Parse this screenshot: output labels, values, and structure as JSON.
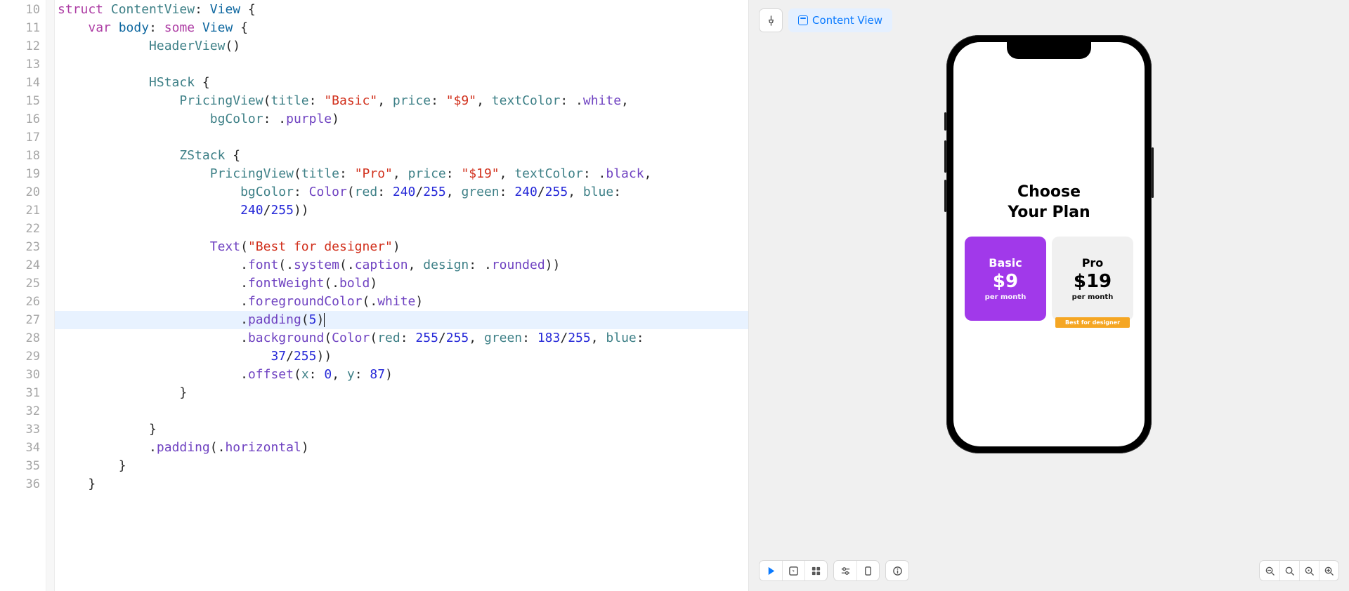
{
  "editor": {
    "startLine": 10,
    "highlightLine": 27,
    "lines": [
      [
        [
          "kw",
          "struct"
        ],
        [
          "plain",
          " "
        ],
        [
          "type",
          "ContentView"
        ],
        [
          "plain",
          ": "
        ],
        [
          "id",
          "View"
        ],
        [
          "plain",
          " {"
        ]
      ],
      [
        [
          "plain",
          "    "
        ],
        [
          "kw",
          "var"
        ],
        [
          "plain",
          " "
        ],
        [
          "id",
          "body"
        ],
        [
          "plain",
          ": "
        ],
        [
          "kw",
          "some"
        ],
        [
          "plain",
          " "
        ],
        [
          "id",
          "View"
        ],
        [
          "plain",
          " {"
        ]
      ],
      [
        [
          "plain",
          "            "
        ],
        [
          "type",
          "HeaderView"
        ],
        [
          "plain",
          "()"
        ]
      ],
      [
        [
          "plain",
          ""
        ]
      ],
      [
        [
          "plain",
          "            "
        ],
        [
          "type",
          "HStack"
        ],
        [
          "plain",
          " {"
        ]
      ],
      [
        [
          "plain",
          "                "
        ],
        [
          "type",
          "PricingView"
        ],
        [
          "plain",
          "("
        ],
        [
          "param",
          "title"
        ],
        [
          "plain",
          ": "
        ],
        [
          "str",
          "\"Basic\""
        ],
        [
          "plain",
          ", "
        ],
        [
          "param",
          "price"
        ],
        [
          "plain",
          ": "
        ],
        [
          "str",
          "\"$9\""
        ],
        [
          "plain",
          ", "
        ],
        [
          "param",
          "textColor"
        ],
        [
          "plain",
          ": ."
        ],
        [
          "enum",
          "white"
        ],
        [
          "plain",
          ","
        ]
      ],
      [
        [
          "plain",
          "                    "
        ],
        [
          "param",
          "bgColor"
        ],
        [
          "plain",
          ": ."
        ],
        [
          "enum",
          "purple"
        ],
        [
          "plain",
          ")"
        ]
      ],
      [
        [
          "plain",
          ""
        ]
      ],
      [
        [
          "plain",
          "                "
        ],
        [
          "type",
          "ZStack"
        ],
        [
          "plain",
          " {"
        ]
      ],
      [
        [
          "plain",
          "                    "
        ],
        [
          "type",
          "PricingView"
        ],
        [
          "plain",
          "("
        ],
        [
          "param",
          "title"
        ],
        [
          "plain",
          ": "
        ],
        [
          "str",
          "\"Pro\""
        ],
        [
          "plain",
          ", "
        ],
        [
          "param",
          "price"
        ],
        [
          "plain",
          ": "
        ],
        [
          "str",
          "\"$19\""
        ],
        [
          "plain",
          ", "
        ],
        [
          "param",
          "textColor"
        ],
        [
          "plain",
          ": ."
        ],
        [
          "enum",
          "black"
        ],
        [
          "plain",
          ","
        ]
      ],
      [
        [
          "plain",
          "                        "
        ],
        [
          "param",
          "bgColor"
        ],
        [
          "plain",
          ": "
        ],
        [
          "typeP",
          "Color"
        ],
        [
          "plain",
          "("
        ],
        [
          "param",
          "red"
        ],
        [
          "plain",
          ": "
        ],
        [
          "num",
          "240"
        ],
        [
          "plain",
          "/"
        ],
        [
          "num",
          "255"
        ],
        [
          "plain",
          ", "
        ],
        [
          "param",
          "green"
        ],
        [
          "plain",
          ": "
        ],
        [
          "num",
          "240"
        ],
        [
          "plain",
          "/"
        ],
        [
          "num",
          "255"
        ],
        [
          "plain",
          ", "
        ],
        [
          "param",
          "blue"
        ],
        [
          "plain",
          ":"
        ]
      ],
      [
        [
          "plain",
          "                        "
        ],
        [
          "num",
          "240"
        ],
        [
          "plain",
          "/"
        ],
        [
          "num",
          "255"
        ],
        [
          "plain",
          "))"
        ]
      ],
      [
        [
          "plain",
          ""
        ]
      ],
      [
        [
          "plain",
          "                    "
        ],
        [
          "typeP",
          "Text"
        ],
        [
          "plain",
          "("
        ],
        [
          "str",
          "\"Best for designer\""
        ],
        [
          "plain",
          ")"
        ]
      ],
      [
        [
          "plain",
          "                        ."
        ],
        [
          "mod",
          "font"
        ],
        [
          "plain",
          "(."
        ],
        [
          "enum",
          "system"
        ],
        [
          "plain",
          "(."
        ],
        [
          "enum",
          "caption"
        ],
        [
          "plain",
          ", "
        ],
        [
          "param",
          "design"
        ],
        [
          "plain",
          ": ."
        ],
        [
          "enum",
          "rounded"
        ],
        [
          "plain",
          "))"
        ]
      ],
      [
        [
          "plain",
          "                        ."
        ],
        [
          "mod",
          "fontWeight"
        ],
        [
          "plain",
          "(."
        ],
        [
          "enum",
          "bold"
        ],
        [
          "plain",
          ")"
        ]
      ],
      [
        [
          "plain",
          "                        ."
        ],
        [
          "mod",
          "foregroundColor"
        ],
        [
          "plain",
          "(."
        ],
        [
          "enum",
          "white"
        ],
        [
          "plain",
          ")"
        ]
      ],
      [
        [
          "plain",
          "                        ."
        ],
        [
          "mod",
          "padding"
        ],
        [
          "plain",
          "("
        ],
        [
          "num",
          "5"
        ],
        [
          "plain",
          ")"
        ]
      ],
      [
        [
          "plain",
          "                        ."
        ],
        [
          "mod",
          "background"
        ],
        [
          "plain",
          "("
        ],
        [
          "typeP",
          "Color"
        ],
        [
          "plain",
          "("
        ],
        [
          "param",
          "red"
        ],
        [
          "plain",
          ": "
        ],
        [
          "num",
          "255"
        ],
        [
          "plain",
          "/"
        ],
        [
          "num",
          "255"
        ],
        [
          "plain",
          ", "
        ],
        [
          "param",
          "green"
        ],
        [
          "plain",
          ": "
        ],
        [
          "num",
          "183"
        ],
        [
          "plain",
          "/"
        ],
        [
          "num",
          "255"
        ],
        [
          "plain",
          ", "
        ],
        [
          "param",
          "blue"
        ],
        [
          "plain",
          ":"
        ]
      ],
      [
        [
          "plain",
          "                            "
        ],
        [
          "num",
          "37"
        ],
        [
          "plain",
          "/"
        ],
        [
          "num",
          "255"
        ],
        [
          "plain",
          "))"
        ]
      ],
      [
        [
          "plain",
          "                        ."
        ],
        [
          "mod",
          "offset"
        ],
        [
          "plain",
          "("
        ],
        [
          "param",
          "x"
        ],
        [
          "plain",
          ": "
        ],
        [
          "num",
          "0"
        ],
        [
          "plain",
          ", "
        ],
        [
          "param",
          "y"
        ],
        [
          "plain",
          ": "
        ],
        [
          "num",
          "87"
        ],
        [
          "plain",
          ")"
        ]
      ],
      [
        [
          "plain",
          "                }"
        ]
      ],
      [
        [
          "plain",
          ""
        ]
      ],
      [
        [
          "plain",
          "            }"
        ]
      ],
      [
        [
          "plain",
          "            ."
        ],
        [
          "mod",
          "padding"
        ],
        [
          "plain",
          "(."
        ],
        [
          "enum",
          "horizontal"
        ],
        [
          "plain",
          ")"
        ]
      ],
      [
        [
          "plain",
          "        }"
        ]
      ],
      [
        [
          "plain",
          "    }"
        ]
      ]
    ]
  },
  "canvas": {
    "chipLabel": "Content View",
    "header1": "Choose",
    "header2": "Your Plan",
    "plans": {
      "basic": {
        "title": "Basic",
        "price": "$9",
        "sub": "per month"
      },
      "pro": {
        "title": "Pro",
        "price": "$19",
        "sub": "per month",
        "badge": "Best for designer"
      }
    }
  }
}
